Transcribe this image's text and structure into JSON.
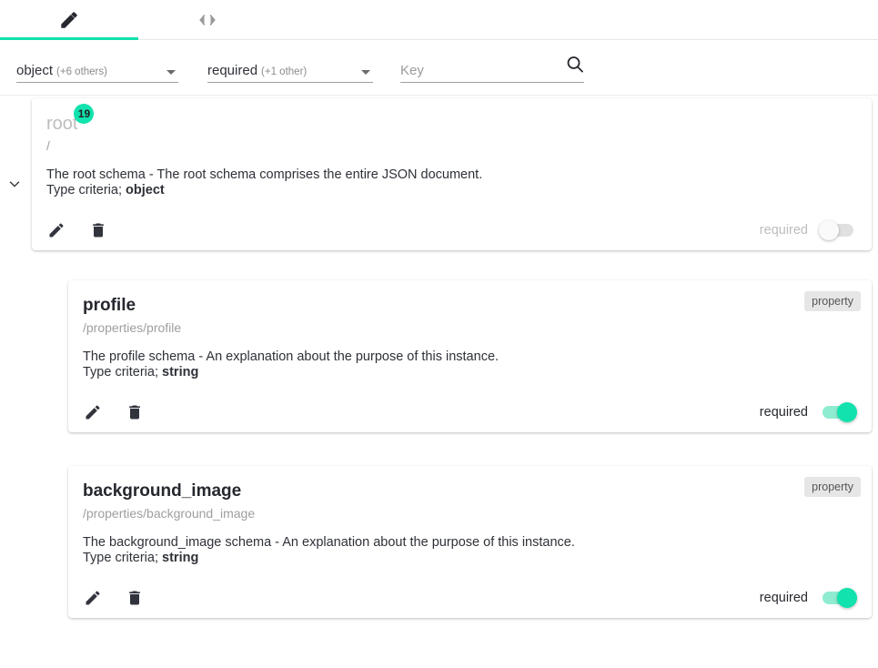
{
  "tabs": [
    {
      "name": "editor",
      "icon": "pencil-icon",
      "active": true
    },
    {
      "name": "code",
      "icon": "code-brackets-icon",
      "active": false
    }
  ],
  "filters": {
    "type": {
      "value": "object",
      "extra": "(+6 others)",
      "icon": "chevron-down-icon"
    },
    "requirement": {
      "value": "required",
      "extra": "(+1 other)",
      "icon": "chevron-down-icon"
    },
    "search": {
      "value": "",
      "placeholder": "Key",
      "icon": "search-icon"
    }
  },
  "colors": {
    "accent": "#12e2ad",
    "accent_track": "#8fecd0",
    "badge_text": "#1d1f24",
    "icon_dark": "#32343d",
    "muted": "#9e9e9e"
  },
  "nodes": [
    {
      "kind": "root",
      "title": "root",
      "badge": "19",
      "path": "/",
      "description": "The root schema - The root schema comprises the entire JSON document.",
      "criteria_label": "Type criteria;",
      "criteria_value": "object",
      "chip": "",
      "required_label": "required",
      "required_on": false,
      "actions": {
        "edit": "edit-icon",
        "delete": "delete-icon"
      }
    },
    {
      "kind": "property",
      "title": "profile",
      "badge": "",
      "path": "/properties/profile",
      "description": "The profile schema - An explanation about the purpose of this instance.",
      "criteria_label": "Type criteria;",
      "criteria_value": "string",
      "chip": "property",
      "required_label": "required",
      "required_on": true,
      "actions": {
        "edit": "edit-icon",
        "delete": "delete-icon"
      }
    },
    {
      "kind": "property",
      "title": "background_image",
      "badge": "",
      "path": "/properties/background_image",
      "description": "The background_image schema - An explanation about the purpose of this instance.",
      "criteria_label": "Type criteria;",
      "criteria_value": "string",
      "chip": "property",
      "required_label": "required",
      "required_on": true,
      "actions": {
        "edit": "edit-icon",
        "delete": "delete-icon"
      }
    }
  ]
}
